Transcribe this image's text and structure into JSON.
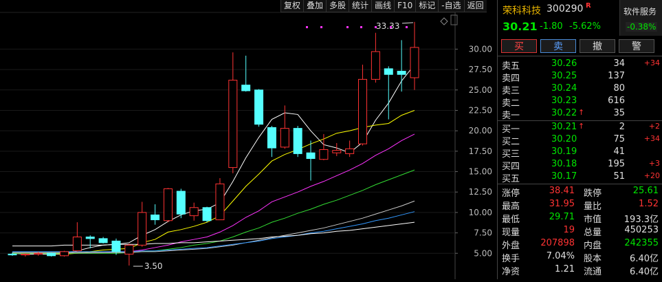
{
  "toolbar": [
    "复权",
    "叠加",
    "多股",
    "统计",
    "画线",
    "F10",
    "标记",
    "-自选",
    "返回"
  ],
  "chart": {
    "y_ticks": [
      "30.00",
      "27.50",
      "25.00",
      "22.50",
      "20.00",
      "17.50",
      "15.00",
      "12.50",
      "10.00",
      "7.50",
      "5.00"
    ],
    "y_values": [
      30,
      27.5,
      25,
      22.5,
      20,
      17.5,
      15,
      12.5,
      10,
      7.5,
      5
    ],
    "high_label": "33.33",
    "low_label": "3.50",
    "colors": {
      "up": "#ff3333",
      "down": "#55ffff",
      "ma5": "#ffffff",
      "ma10": "#ffff00",
      "ma20": "#ff33ff",
      "ma30": "#33dd33",
      "ma60": "#cccccc",
      "ma120": "#3399ff",
      "ma250": "#ffffff"
    }
  },
  "chart_data": {
    "type": "candlestick",
    "y_range": [
      3.0,
      34.5
    ],
    "candles": [
      {
        "o": 4.9,
        "h": 5.1,
        "l": 4.7,
        "c": 4.8
      },
      {
        "o": 4.8,
        "h": 5.0,
        "l": 4.6,
        "c": 4.9
      },
      {
        "o": 4.9,
        "h": 5.2,
        "l": 4.7,
        "c": 5.0
      },
      {
        "o": 5.0,
        "h": 5.1,
        "l": 4.6,
        "c": 4.7
      },
      {
        "o": 4.7,
        "h": 5.3,
        "l": 4.6,
        "c": 5.2
      },
      {
        "o": 5.3,
        "h": 8.8,
        "l": 5.2,
        "c": 7.0
      },
      {
        "o": 7.0,
        "h": 7.2,
        "l": 5.6,
        "c": 6.8
      },
      {
        "o": 6.8,
        "h": 7.0,
        "l": 6.2,
        "c": 6.3
      },
      {
        "o": 6.5,
        "h": 6.8,
        "l": 4.8,
        "c": 5.2
      },
      {
        "o": 4.9,
        "h": 6.2,
        "l": 3.5,
        "c": 6.0
      },
      {
        "o": 6.0,
        "h": 11.3,
        "l": 5.8,
        "c": 10.0
      },
      {
        "o": 9.7,
        "h": 11.0,
        "l": 8.5,
        "c": 9.1
      },
      {
        "o": 9.0,
        "h": 13.0,
        "l": 8.8,
        "c": 12.9
      },
      {
        "o": 12.6,
        "h": 12.9,
        "l": 9.3,
        "c": 9.8
      },
      {
        "o": 9.6,
        "h": 11.2,
        "l": 9.0,
        "c": 10.6
      },
      {
        "o": 10.6,
        "h": 10.7,
        "l": 8.8,
        "c": 9.0
      },
      {
        "o": 9.1,
        "h": 14.2,
        "l": 9.1,
        "c": 13.5
      },
      {
        "o": 15.5,
        "h": 29.6,
        "l": 14.8,
        "c": 26.2
      },
      {
        "o": 25.6,
        "h": 29.2,
        "l": 24.8,
        "c": 24.9
      },
      {
        "o": 25.0,
        "h": 25.1,
        "l": 20.5,
        "c": 20.8
      },
      {
        "o": 20.4,
        "h": 20.6,
        "l": 16.8,
        "c": 17.9
      },
      {
        "o": 18.0,
        "h": 23.1,
        "l": 17.8,
        "c": 20.3
      },
      {
        "o": 20.3,
        "h": 20.6,
        "l": 16.8,
        "c": 17.2
      },
      {
        "o": 17.3,
        "h": 18.8,
        "l": 13.9,
        "c": 16.6
      },
      {
        "o": 16.5,
        "h": 19.6,
        "l": 16.4,
        "c": 17.7
      },
      {
        "o": 17.3,
        "h": 18.5,
        "l": 16.9,
        "c": 17.6
      },
      {
        "o": 17.2,
        "h": 18.8,
        "l": 16.8,
        "c": 17.8
      },
      {
        "o": 18.4,
        "h": 28.1,
        "l": 18.2,
        "c": 26.3
      },
      {
        "o": 26.3,
        "h": 32.0,
        "l": 25.9,
        "c": 29.7
      },
      {
        "o": 27.6,
        "h": 27.9,
        "l": 21.4,
        "c": 26.9
      },
      {
        "o": 27.3,
        "h": 31.1,
        "l": 24.8,
        "c": 26.9
      },
      {
        "o": 26.5,
        "h": 33.33,
        "l": 25.0,
        "c": 30.21
      }
    ],
    "ma": {
      "ma5": [
        5.0,
        4.9,
        4.9,
        4.9,
        4.9,
        5.3,
        5.7,
        6.0,
        6.1,
        6.3,
        7.2,
        7.9,
        8.9,
        9.7,
        10.2,
        10.4,
        11.2,
        13.8,
        16.7,
        19.2,
        21.4,
        22.2,
        22.0,
        20.0,
        18.3,
        17.9,
        17.3,
        18.6,
        21.3,
        23.4,
        26.1,
        28.1
      ],
      "ma10": [
        5.0,
        5.0,
        5.0,
        5.0,
        4.9,
        5.0,
        5.2,
        5.4,
        5.5,
        5.6,
        6.3,
        6.7,
        7.6,
        7.9,
        8.3,
        8.8,
        9.6,
        11.4,
        13.2,
        14.7,
        16.3,
        17.1,
        17.7,
        18.4,
        19.0,
        19.7,
        20.0,
        20.4,
        20.7,
        20.9,
        21.9,
        22.5
      ],
      "ma20": [
        5.0,
        5.0,
        5.0,
        5.0,
        5.0,
        5.0,
        5.0,
        5.1,
        5.2,
        5.2,
        5.4,
        5.7,
        6.0,
        6.4,
        6.7,
        7.0,
        7.6,
        8.4,
        9.4,
        10.2,
        11.3,
        11.9,
        12.5,
        13.2,
        13.8,
        14.5,
        15.2,
        16.0,
        17.0,
        17.8,
        18.8,
        19.6
      ],
      "ma30": [
        5.0,
        5.0,
        5.0,
        5.0,
        5.0,
        5.0,
        5.0,
        5.0,
        5.0,
        5.1,
        5.2,
        5.3,
        5.5,
        5.7,
        6.0,
        6.2,
        6.5,
        7.0,
        7.6,
        8.1,
        8.8,
        9.3,
        9.9,
        10.4,
        11.0,
        11.5,
        12.1,
        12.7,
        13.4,
        14.0,
        14.6,
        15.2
      ],
      "ma60": [
        5.1,
        5.1,
        5.1,
        5.1,
        5.1,
        5.1,
        5.1,
        5.1,
        5.1,
        5.1,
        5.2,
        5.2,
        5.3,
        5.4,
        5.5,
        5.6,
        5.8,
        6.0,
        6.3,
        6.6,
        6.9,
        7.2,
        7.5,
        7.8,
        8.1,
        8.5,
        8.9,
        9.3,
        9.8,
        10.3,
        10.8,
        11.4
      ],
      "ma120": [
        5.2,
        5.2,
        5.2,
        5.2,
        5.2,
        5.2,
        5.2,
        5.2,
        5.2,
        5.2,
        5.3,
        5.3,
        5.4,
        5.5,
        5.6,
        5.7,
        5.9,
        6.1,
        6.3,
        6.5,
        6.8,
        7.0,
        7.2,
        7.5,
        7.7,
        8.0,
        8.3,
        8.6,
        9.0,
        9.3,
        9.7,
        10.1
      ],
      "ma250": [
        5.9,
        5.9,
        5.9,
        5.9,
        6.0,
        6.0,
        6.0,
        6.0,
        6.1,
        6.1,
        6.1,
        6.2,
        6.2,
        6.3,
        6.3,
        6.4,
        6.5,
        6.6,
        6.7,
        6.8,
        7.0,
        7.1,
        7.2,
        7.4,
        7.5,
        7.7,
        7.8,
        8.0,
        8.2,
        8.4,
        8.6,
        8.8
      ]
    }
  },
  "stock": {
    "name": "荣科科技",
    "code": "300290",
    "badge": "R",
    "price": "30.21",
    "change": "-1.80",
    "change_pct": "-5.62%",
    "sector_name": "软件服务",
    "sector_pct": "-0.38%"
  },
  "trade_buttons": [
    "买",
    "卖",
    "撤",
    "警"
  ],
  "asks": [
    {
      "label": "卖五",
      "price": "30.26",
      "vol": "34",
      "delta": "+34",
      "arrow": ""
    },
    {
      "label": "卖四",
      "price": "30.25",
      "vol": "137",
      "delta": "",
      "arrow": ""
    },
    {
      "label": "卖三",
      "price": "30.24",
      "vol": "80",
      "delta": "",
      "arrow": ""
    },
    {
      "label": "卖二",
      "price": "30.23",
      "vol": "616",
      "delta": "",
      "arrow": ""
    },
    {
      "label": "卖一",
      "price": "30.22",
      "vol": "35",
      "delta": "",
      "arrow": "↑"
    }
  ],
  "bids": [
    {
      "label": "买一",
      "price": "30.21",
      "vol": "2",
      "delta": "+2",
      "arrow": "↑"
    },
    {
      "label": "买二",
      "price": "30.20",
      "vol": "75",
      "delta": "+34",
      "arrow": ""
    },
    {
      "label": "买三",
      "price": "30.19",
      "vol": "41",
      "delta": "",
      "arrow": ""
    },
    {
      "label": "买四",
      "price": "30.18",
      "vol": "195",
      "delta": "+3",
      "arrow": ""
    },
    {
      "label": "买五",
      "price": "30.17",
      "vol": "51",
      "delta": "+20",
      "arrow": ""
    }
  ],
  "stats": [
    [
      {
        "l": "涨停",
        "v": "38.41",
        "c": "red"
      },
      {
        "l": "跌停",
        "v": "25.61",
        "c": "green"
      }
    ],
    [
      {
        "l": "最高",
        "v": "31.95",
        "c": "red"
      },
      {
        "l": "量比",
        "v": "1.52",
        "c": "red"
      }
    ],
    [
      {
        "l": "最低",
        "v": "29.71",
        "c": "green"
      },
      {
        "l": "市值",
        "v": "193.3亿",
        "c": "wht"
      }
    ],
    [
      {
        "l": "现量",
        "v": "19",
        "c": "red"
      },
      {
        "l": "总量",
        "v": "450253",
        "c": "wht"
      }
    ],
    [
      {
        "l": "外盘",
        "v": "207898",
        "c": "red"
      },
      {
        "l": "内盘",
        "v": "242355",
        "c": "green"
      }
    ],
    [
      {
        "l": "换手",
        "v": "7.04%",
        "c": "wht"
      },
      {
        "l": "股本",
        "v": "6.40亿",
        "c": "wht"
      }
    ],
    [
      {
        "l": "净资",
        "v": "1.21",
        "c": "wht"
      },
      {
        "l": "流通",
        "v": "6.40亿",
        "c": "wht"
      }
    ]
  ]
}
